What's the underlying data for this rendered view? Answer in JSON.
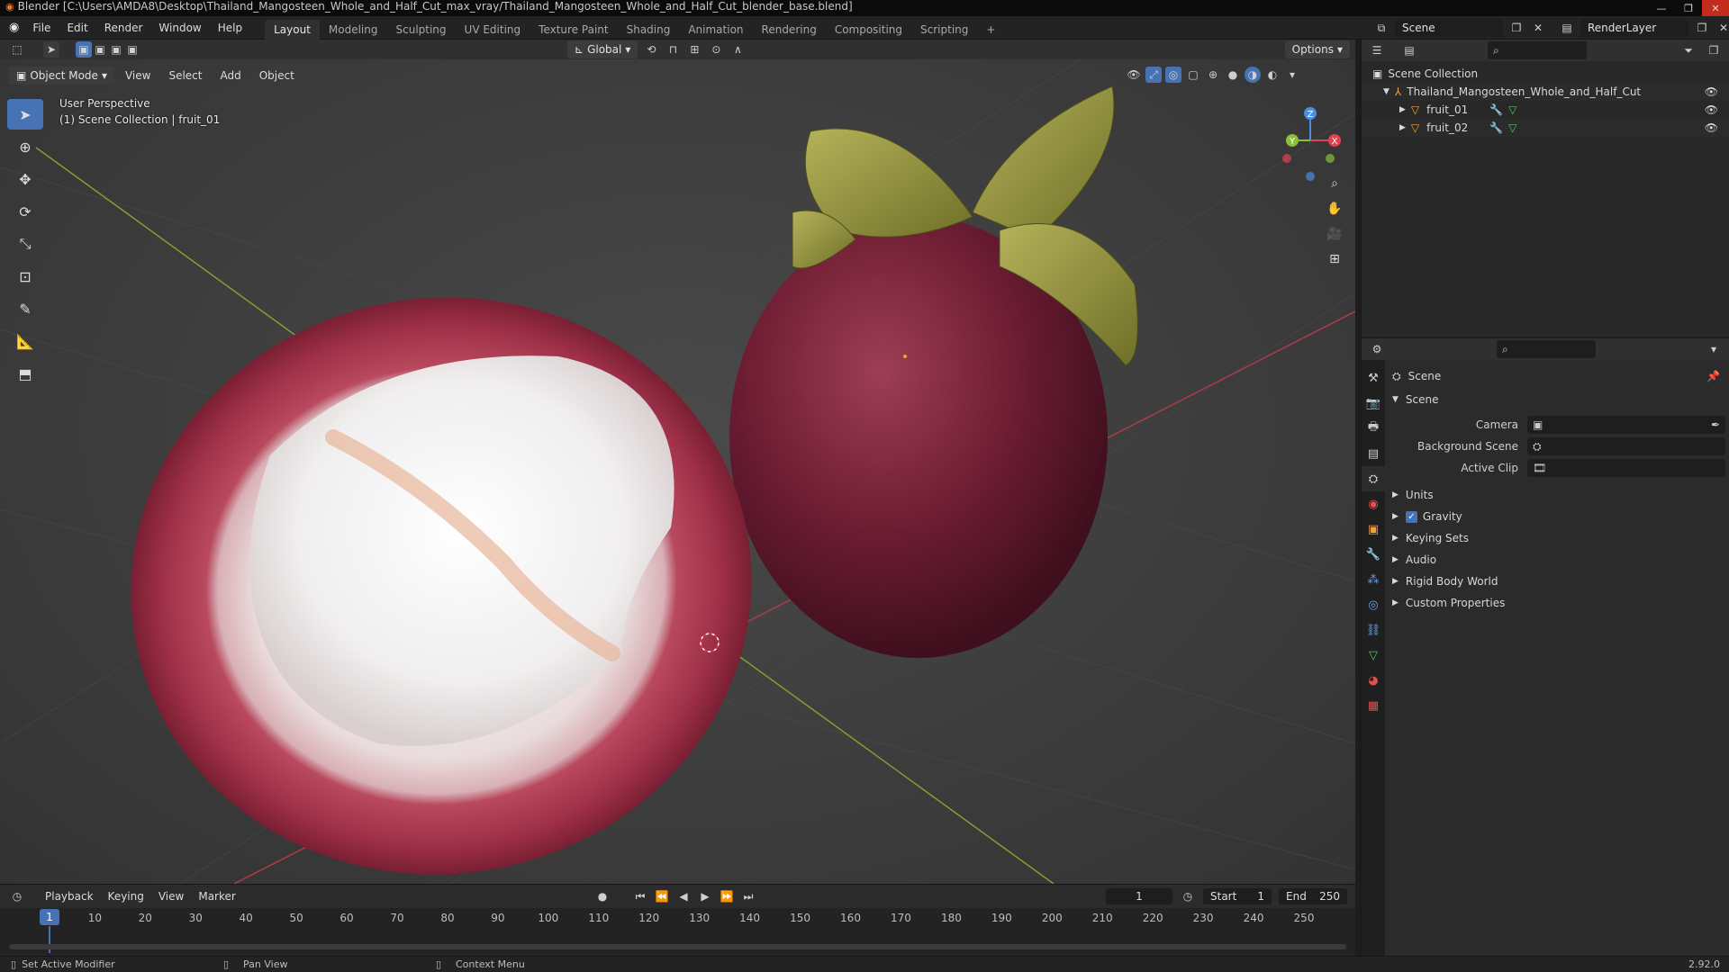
{
  "window": {
    "title": "Blender [C:\\Users\\AMDA8\\Desktop\\Thailand_Mangosteen_Whole_and_Half_Cut_max_vray/Thailand_Mangosteen_Whole_and_Half_Cut_blender_base.blend]"
  },
  "menu": [
    "File",
    "Edit",
    "Render",
    "Window",
    "Help"
  ],
  "workspaces": [
    "Layout",
    "Modeling",
    "Sculpting",
    "UV Editing",
    "Texture Paint",
    "Shading",
    "Animation",
    "Rendering",
    "Compositing",
    "Scripting"
  ],
  "active_workspace": "Layout",
  "scene_selector": {
    "label": "Scene"
  },
  "view_layer": {
    "label": "RenderLayer"
  },
  "viewport_header": {
    "transform_orientation": "Global",
    "options": "Options",
    "mode": "Object Mode",
    "menus": [
      "View",
      "Select",
      "Add",
      "Object"
    ]
  },
  "viewport": {
    "perspective": "User Perspective",
    "collection_info": "(1) Scene Collection | fruit_01",
    "gizmo_axes": {
      "x": "X",
      "y": "Y",
      "z": "Z"
    }
  },
  "outliner": {
    "root": "Scene Collection",
    "collection": "Thailand_Mangosteen_Whole_and_Half_Cut",
    "objects": [
      "fruit_01",
      "fruit_02"
    ]
  },
  "properties": {
    "context_title": "Scene",
    "panel_title": "Scene",
    "fields": [
      {
        "label": "Camera",
        "value": ""
      },
      {
        "label": "Background Scene",
        "value": ""
      },
      {
        "label": "Active Clip",
        "value": ""
      }
    ],
    "panels": [
      "Units",
      "Gravity",
      "Keying Sets",
      "Audio",
      "Rigid Body World",
      "Custom Properties"
    ],
    "gravity_checked": true
  },
  "timeline": {
    "menus": [
      "Playback",
      "Keying",
      "View",
      "Marker"
    ],
    "current_frame": "1",
    "start_label": "Start",
    "start": "1",
    "end_label": "End",
    "end": "250",
    "ticks": [
      "1",
      "10",
      "20",
      "30",
      "40",
      "50",
      "60",
      "70",
      "80",
      "90",
      "100",
      "110",
      "120",
      "130",
      "140",
      "150",
      "160",
      "170",
      "180",
      "190",
      "200",
      "210",
      "220",
      "230",
      "240",
      "250"
    ]
  },
  "status_bar": {
    "left": "Set Active Modifier",
    "middle": "Pan View",
    "right": "Context Menu",
    "version": "2.92.0"
  },
  "colors": {
    "accent": "#4772b3",
    "axis_x": "#e0434f",
    "axis_y": "#8bbf3a",
    "axis_z": "#4a8fe0"
  }
}
